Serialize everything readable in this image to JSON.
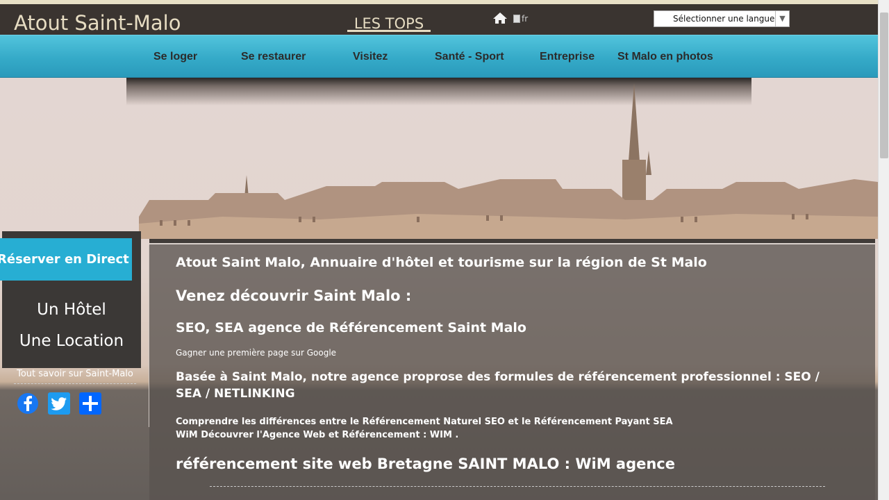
{
  "header": {
    "site_title": "Atout Saint-Malo",
    "tops_label": "LES TOPS",
    "flag_alt": "fr",
    "language_select": "Sélectionner une langue"
  },
  "nav": {
    "items": [
      {
        "label": "Se loger"
      },
      {
        "label": "Se restaurer"
      },
      {
        "label": "Visitez"
      },
      {
        "label": "Santé - Sport"
      },
      {
        "label": "Entreprise"
      },
      {
        "label": "St Malo en photos"
      }
    ]
  },
  "sidebar": {
    "reserve_button": "Réserver en Direct",
    "link_hotel": "Un Hôtel",
    "link_location": "Une Location",
    "tout_savoir": "Tout savoir sur Saint-Malo",
    "share_icons": [
      "facebook-icon",
      "twitter-icon",
      "share-icon"
    ]
  },
  "content": {
    "heading_main": "Atout Saint Malo, Annuaire d'hôtel et tourisme sur la région de St Malo",
    "heading_discover": "Venez découvrir Saint Malo :",
    "heading_seo": "SEO, SEA agence de Référencement Saint Malo",
    "google_line": "Gagner une première page sur Google",
    "agency_text": "Basée à Saint Malo, notre agence proprose des formules de référencement professionnel : SEO / SEA / NETLINKING",
    "link_compare": "Comprendre les différences entre le Référencement Naturel SEO et le Référencement Payant SEA",
    "link_wim": "WiM Découvrer l'Agence Web et Référencement : WIM .",
    "heading_bretagne": "référencement site web Bretagne SAINT MALO : WiM agence"
  },
  "colors": {
    "nav_blue": "#35aac8",
    "reserve_blue": "#27aed3",
    "topbar": "#3a3430"
  }
}
